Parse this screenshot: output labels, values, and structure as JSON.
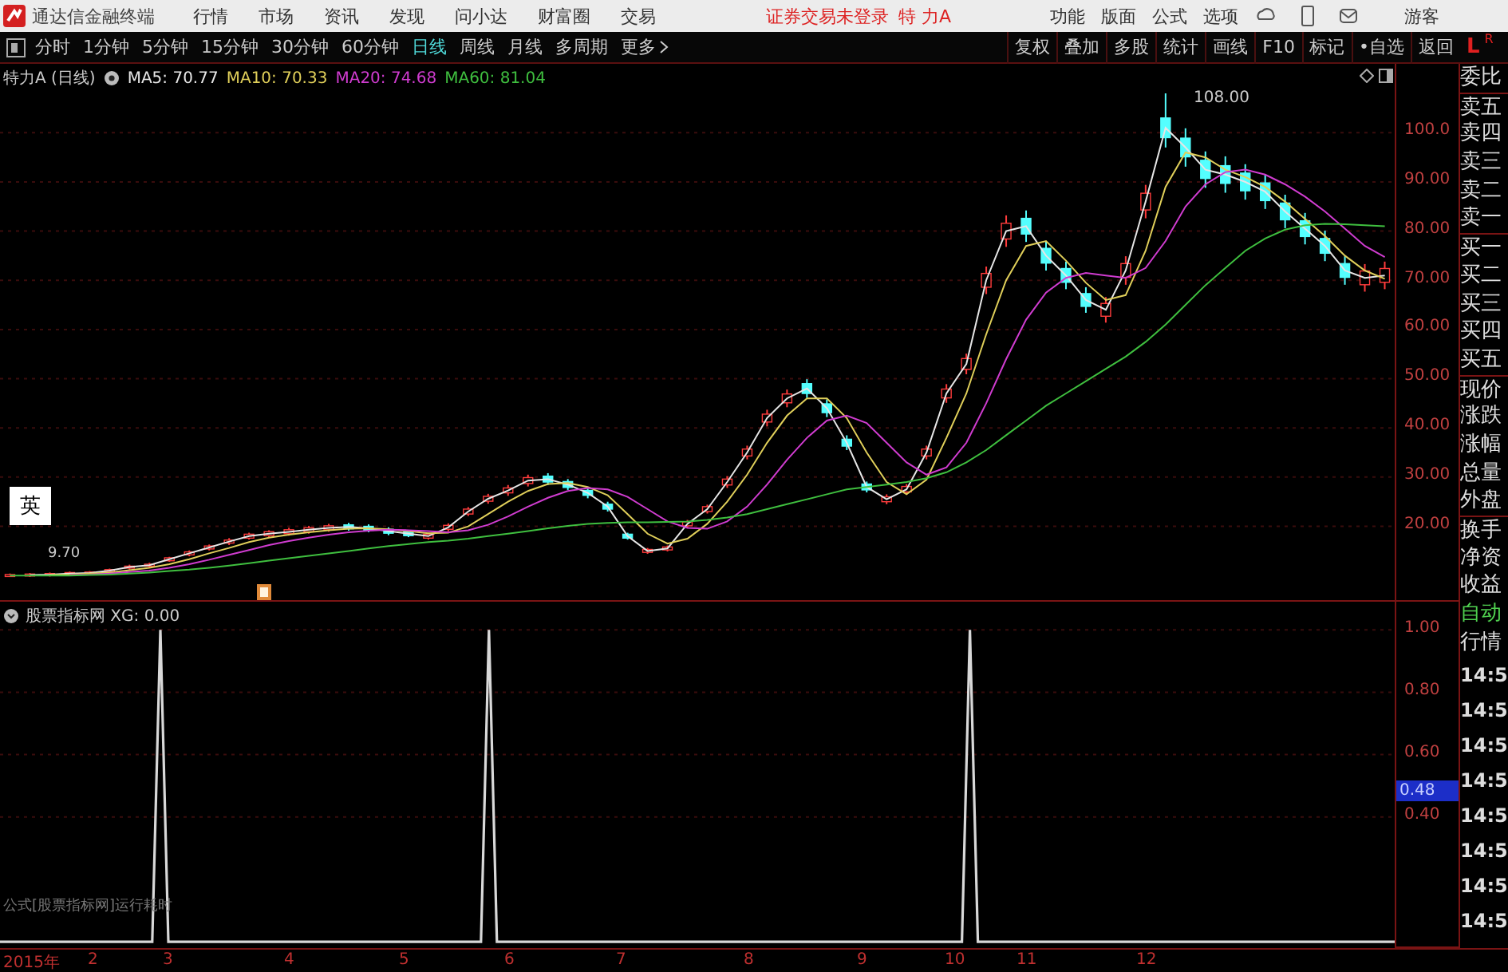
{
  "app": {
    "title": "通达信金融终端",
    "menus": [
      "行情",
      "市场",
      "资讯",
      "发现",
      "问小达",
      "财富圈",
      "交易"
    ],
    "login_status": "证券交易未登录",
    "stock_name": "特 力A",
    "tools": [
      "功能",
      "版面",
      "公式",
      "选项"
    ],
    "user": "游客"
  },
  "periods": [
    {
      "label": "分时",
      "selected": false
    },
    {
      "label": "1分钟",
      "selected": false
    },
    {
      "label": "5分钟",
      "selected": false
    },
    {
      "label": "15分钟",
      "selected": false
    },
    {
      "label": "30分钟",
      "selected": false
    },
    {
      "label": "60分钟",
      "selected": false
    },
    {
      "label": "日线",
      "selected": true
    },
    {
      "label": "周线",
      "selected": false
    },
    {
      "label": "月线",
      "selected": false
    },
    {
      "label": "多周期",
      "selected": false
    },
    {
      "label": "更多",
      "selected": false
    }
  ],
  "actions": [
    "复权",
    "叠加",
    "多股",
    "统计",
    "画线",
    "F10",
    "标记",
    "•自选",
    "返回"
  ],
  "corner": {
    "left": "L",
    "right": "R"
  },
  "legend": {
    "title": "特力A (日线)",
    "ma": [
      {
        "label": "MA5: 70.77",
        "color": "#e6e6e6"
      },
      {
        "label": "MA10: 70.33",
        "color": "#e0cf5a"
      },
      {
        "label": "MA20: 74.68",
        "color": "#d03cd0"
      },
      {
        "label": "MA60: 81.04",
        "color": "#3fbf3f"
      }
    ]
  },
  "price_chart": {
    "high_label": "108.00",
    "low_label": "9.70",
    "chart_data": {
      "type": "candlestick",
      "ylim": [
        5,
        114
      ],
      "grid": true,
      "ohlc": [
        [
          9.8,
          10.4,
          9.7,
          10.2
        ],
        [
          9.9,
          10.5,
          9.7,
          10.3
        ],
        [
          10,
          10.6,
          9.8,
          10.4
        ],
        [
          10.2,
          10.8,
          10,
          10.6
        ],
        [
          10.3,
          10.9,
          10.1,
          10.7
        ],
        [
          10.8,
          11.4,
          10.6,
          11.2
        ],
        [
          11.5,
          12.2,
          11.2,
          11.9
        ],
        [
          11.9,
          12.6,
          11.6,
          12.3
        ],
        [
          13,
          13.8,
          12.8,
          13.6
        ],
        [
          14.2,
          15.1,
          13.9,
          14.8
        ],
        [
          15.4,
          16.3,
          15.1,
          16
        ],
        [
          16.6,
          17.6,
          16.2,
          17.2
        ],
        [
          17.6,
          18.7,
          17.3,
          18.4
        ],
        [
          18.1,
          19.2,
          17.8,
          18.9
        ],
        [
          18.5,
          19.7,
          18.1,
          19.3
        ],
        [
          18.9,
          20.1,
          18.5,
          19.7
        ],
        [
          19.3,
          20.5,
          18.9,
          20.1
        ],
        [
          20.3,
          20.7,
          19.1,
          19.5
        ],
        [
          20,
          20.4,
          18.8,
          19.2
        ],
        [
          19.4,
          19.8,
          18.2,
          18.6
        ],
        [
          18.9,
          19.2,
          17.8,
          18.1
        ],
        [
          17.6,
          18.7,
          17.3,
          18.4
        ],
        [
          19.4,
          20.6,
          19,
          20.2
        ],
        [
          22.5,
          23.9,
          22.1,
          23.5
        ],
        [
          25.1,
          26.6,
          24.6,
          26.1
        ],
        [
          26.8,
          28.4,
          26.2,
          27.8
        ],
        [
          28.7,
          30.5,
          28.1,
          29.9
        ],
        [
          30.2,
          30.8,
          28.4,
          29
        ],
        [
          29.1,
          29.6,
          27.4,
          27.9
        ],
        [
          27.3,
          27.9,
          25.7,
          26.3
        ],
        [
          24.5,
          25,
          23,
          23.5
        ],
        [
          18.4,
          18.7,
          17.3,
          17.6
        ],
        [
          14.7,
          15.6,
          14.4,
          15.3
        ],
        [
          15.2,
          16.1,
          14.9,
          15.8
        ],
        [
          20.1,
          21.3,
          19.7,
          20.9
        ],
        [
          23,
          24.4,
          22.6,
          24
        ],
        [
          28.4,
          30.2,
          27.8,
          29.6
        ],
        [
          34.3,
          36.4,
          33.6,
          35.7
        ],
        [
          41.2,
          43.7,
          40.3,
          42.8
        ],
        [
          45.1,
          47.8,
          44.2,
          46.9
        ],
        [
          49,
          49.9,
          46.1,
          47
        ],
        [
          44.9,
          45.8,
          42.2,
          43.1
        ],
        [
          37.7,
          38.5,
          35.5,
          36.3
        ],
        [
          28.6,
          29.1,
          26.9,
          27.4
        ],
        [
          25,
          26.5,
          24.5,
          26
        ],
        [
          27,
          28.6,
          26.4,
          28.1
        ],
        [
          34.3,
          36.4,
          33.6,
          35.7
        ],
        [
          46.1,
          48.9,
          45.1,
          47.9
        ],
        [
          51.9,
          55.1,
          50.9,
          54.1
        ],
        [
          68.6,
          72.8,
          67.2,
          71.4
        ],
        [
          78.4,
          83.2,
          76.8,
          81.6
        ],
        [
          82.6,
          84.2,
          77.8,
          79.4
        ],
        [
          76.5,
          78,
          72,
          73.5
        ],
        [
          72.4,
          73.8,
          68.2,
          69.6
        ],
        [
          67.3,
          68.6,
          63.4,
          64.7
        ],
        [
          62.7,
          66.6,
          61.4,
          65.3
        ],
        [
          70.6,
          74.9,
          69.1,
          73.4
        ],
        [
          84.3,
          89.4,
          82.6,
          87.7
        ],
        [
          103,
          108,
          97,
          99
        ],
        [
          98.9,
          100.9,
          93.1,
          95.1
        ],
        [
          94.4,
          96.2,
          88.8,
          90.7
        ],
        [
          93.3,
          95.2,
          87.8,
          89.7
        ],
        [
          91.8,
          93.6,
          86.4,
          88.2
        ],
        [
          89.8,
          91.5,
          84.5,
          86.2
        ],
        [
          85.7,
          87.4,
          80.6,
          82.3
        ],
        [
          82.1,
          83.7,
          77.3,
          78.9
        ],
        [
          78.5,
          80.1,
          73.9,
          75.5
        ],
        [
          73.4,
          74.9,
          69.1,
          70.6
        ],
        [
          69.1,
          73.3,
          67.7,
          71.9
        ],
        [
          69.6,
          73.8,
          68.2,
          72.4
        ]
      ],
      "yticks": [
        {
          "value": 100,
          "label": "100.0"
        },
        {
          "value": 90,
          "label": "90.00"
        },
        {
          "value": 80,
          "label": "80.00"
        },
        {
          "value": 70,
          "label": "70.00"
        },
        {
          "value": 60,
          "label": "60.00"
        },
        {
          "value": 50,
          "label": "50.00"
        },
        {
          "value": 40,
          "label": "40.00"
        },
        {
          "value": 30,
          "label": "30.00"
        },
        {
          "value": 20,
          "label": "20.00"
        }
      ],
      "series": [
        {
          "type": "line",
          "color": "#e6e6e6",
          "values": [
            null,
            10.1,
            10.2,
            10.4,
            10.5,
            11,
            11.7,
            12.1,
            13.3,
            14.5,
            15.7,
            16.9,
            18,
            18.5,
            18.9,
            19.3,
            19.7,
            19.9,
            19.6,
            19,
            18.5,
            18,
            19.8,
            23,
            25.6,
            27.3,
            29.3,
            29.6,
            28.5,
            26.8,
            24,
            18,
            15,
            15.5,
            20.5,
            23.5,
            29,
            35,
            42,
            46,
            48,
            44,
            37,
            28,
            25.5,
            27.5,
            35,
            47,
            53,
            70,
            80,
            81,
            75,
            71,
            66,
            64,
            72,
            86,
            101,
            97,
            92.5,
            91.5,
            90,
            88,
            84,
            80.5,
            77,
            72,
            70.5,
            71
          ]
        },
        {
          "type": "line",
          "color": "#e0cf5a",
          "values": [
            null,
            null,
            10.1,
            10.2,
            10.4,
            10.6,
            11.1,
            11.6,
            12.3,
            13.3,
            14.5,
            15.6,
            16.8,
            17.7,
            18.3,
            18.8,
            19.2,
            19.5,
            19.6,
            19.4,
            19,
            18.6,
            18.7,
            20,
            22.5,
            25,
            27.2,
            28.6,
            28.8,
            28,
            26.3,
            22.5,
            18.5,
            16.5,
            17.5,
            20.5,
            25,
            30.5,
            37,
            42.5,
            46,
            46,
            42,
            35,
            29,
            26.5,
            29.5,
            38,
            47,
            59,
            70,
            77,
            78,
            74,
            69.5,
            66,
            67,
            76,
            89,
            96,
            95,
            92.5,
            91,
            89,
            86,
            82.5,
            79,
            75,
            72,
            70.3
          ]
        },
        {
          "type": "line",
          "color": "#d03cd0",
          "values": [
            null,
            null,
            null,
            10.1,
            10.2,
            10.4,
            10.7,
            11,
            11.6,
            12.3,
            13.2,
            14.2,
            15.2,
            16.2,
            17,
            17.7,
            18.3,
            18.8,
            19.1,
            19.3,
            19.2,
            19,
            18.8,
            19.2,
            20.3,
            22,
            24,
            25.8,
            27.2,
            27.8,
            27.5,
            26,
            23.5,
            21,
            19.7,
            19.5,
            21,
            24,
            28.5,
            33.5,
            38,
            41.5,
            42.5,
            41,
            37,
            33,
            30.5,
            32,
            37,
            45,
            54,
            62,
            67.5,
            70.5,
            71.5,
            71,
            70.5,
            72.5,
            78,
            85,
            89.5,
            92,
            92.5,
            91.5,
            89.5,
            87,
            84,
            80.5,
            77,
            74.7
          ]
        },
        {
          "type": "line",
          "color": "#3fbf3f",
          "values": [
            10,
            10,
            10,
            10,
            10.1,
            10.2,
            10.4,
            10.6,
            10.9,
            11.2,
            11.6,
            12,
            12.5,
            13,
            13.5,
            14,
            14.5,
            15,
            15.5,
            16,
            16.4,
            16.8,
            17.1,
            17.5,
            18,
            18.5,
            19,
            19.6,
            20.1,
            20.5,
            20.7,
            20.8,
            20.8,
            20.9,
            21,
            21.3,
            21.8,
            22.5,
            23.5,
            24.5,
            25.5,
            26.5,
            27.5,
            28,
            28.5,
            29,
            29.8,
            31,
            33,
            35.5,
            38.5,
            41.5,
            44.5,
            47,
            49.5,
            52,
            54.5,
            57.5,
            61,
            65,
            69,
            72.5,
            76,
            78.5,
            80.3,
            81.2,
            81.5,
            81.4,
            81.2,
            81
          ]
        }
      ]
    }
  },
  "ime_badge": "英",
  "indicator": {
    "title": "股票指标网 XG: 0.00",
    "footer": "公式[股票指标网]运行耗时",
    "cursor_value": "0.48",
    "chart_data": {
      "type": "line",
      "ylim": [
        -0.02,
        1.09
      ],
      "grid": true,
      "yticks": [
        {
          "value": 1,
          "label": "1.00"
        },
        {
          "value": 0.8,
          "label": "0.80"
        },
        {
          "value": 0.6,
          "label": "0.60"
        },
        {
          "value": 0.4,
          "label": "0.40"
        }
      ],
      "series": [
        {
          "color": "#d8d8d8",
          "values": [
            0,
            0,
            0,
            0,
            0,
            0,
            0,
            0,
            0,
            0,
            0,
            0,
            0,
            0,
            0,
            0,
            0,
            0,
            0,
            0,
            1,
            0,
            0,
            0,
            0,
            0,
            0,
            0,
            0,
            0,
            0,
            0,
            0,
            0,
            0,
            0,
            0,
            0,
            0,
            0,
            0,
            0,
            0,
            0,
            0,
            0,
            0,
            0,
            0,
            0,
            0,
            0,
            0,
            0,
            0,
            0,
            0,
            0,
            0,
            0,
            0,
            1,
            0,
            0,
            0,
            0,
            0,
            0,
            0,
            0,
            0,
            0,
            0,
            0,
            0,
            0,
            0,
            0,
            0,
            0,
            0,
            0,
            0,
            0,
            0,
            0,
            0,
            0,
            0,
            0,
            0,
            0,
            0,
            0,
            0,
            0,
            0,
            0,
            0,
            0,
            0,
            0,
            0,
            0,
            0,
            0,
            0,
            0,
            0,
            0,
            0,
            0,
            0,
            0,
            0,
            0,
            0,
            0,
            0,
            0,
            0,
            1,
            0,
            0,
            0,
            0,
            0,
            0,
            0,
            0,
            0,
            0,
            0,
            0,
            0,
            0,
            0,
            0,
            0,
            0,
            0,
            0,
            0,
            0,
            0,
            0,
            0,
            0,
            0,
            0,
            0,
            0,
            0,
            0,
            0,
            0,
            0,
            0,
            0,
            0,
            0,
            0,
            0,
            0,
            0,
            0,
            0,
            0,
            0,
            0,
            0,
            0,
            0,
            0,
            0
          ]
        }
      ]
    }
  },
  "sidebar": {
    "quote_labels": [
      "委比",
      "卖五",
      "卖四",
      "卖三",
      "卖二",
      "卖一",
      "买一",
      "买二",
      "买三",
      "买四",
      "买五",
      "现价",
      "涨跌",
      "涨幅",
      "总量",
      "外盘",
      "换手",
      "净资",
      "收益"
    ],
    "auto_labels": [
      "自动",
      "行情"
    ],
    "times": [
      "14:5",
      "14:5",
      "14:5",
      "14:5",
      "14:5",
      "14:5",
      "14:5",
      "14:5"
    ]
  },
  "x_axis": [
    "2015年",
    "2",
    "3",
    "4",
    "5",
    "6",
    "7",
    "8",
    "9",
    "10",
    "11",
    "12"
  ]
}
